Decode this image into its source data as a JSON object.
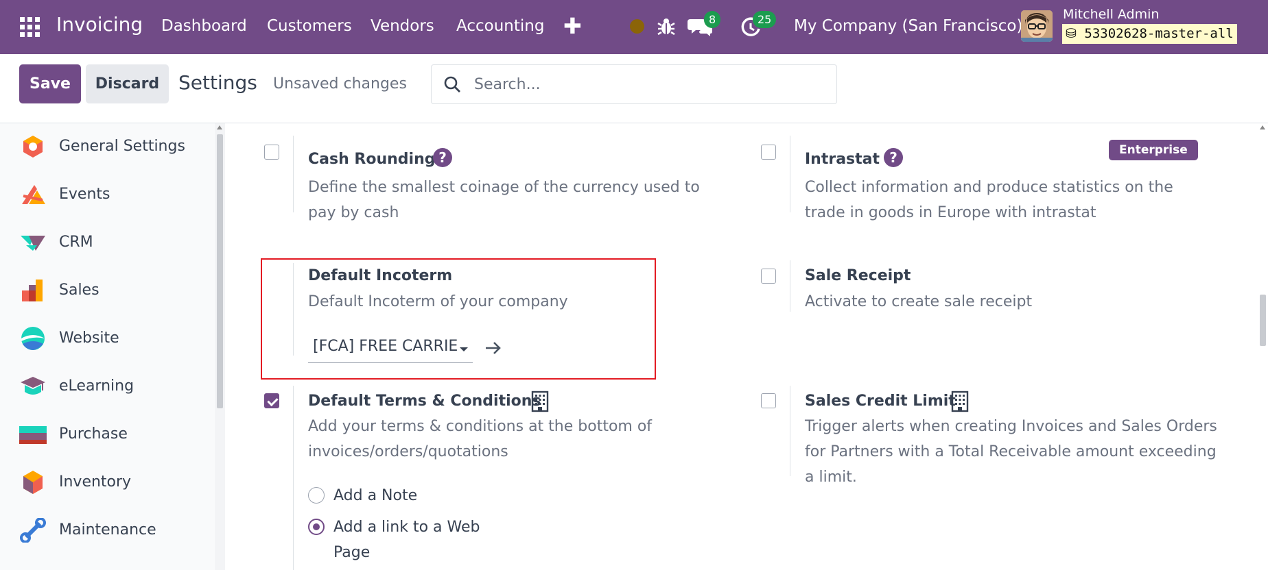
{
  "navbar": {
    "app_name": "Invoicing",
    "menu": [
      "Dashboard",
      "Customers",
      "Vendors",
      "Accounting"
    ],
    "plus_icon": "plus-icon",
    "chat_count": "8",
    "activity_count": "25",
    "company": "My Company (San Francisco)",
    "user_name": "Mitchell Admin",
    "database": "53302628-master-all",
    "colors": {
      "bar": "#714B87",
      "badge": "#1C9C4F",
      "status_dot": "#8B6408"
    }
  },
  "control_panel": {
    "save_label": "Save",
    "discard_label": "Discard",
    "title": "Settings",
    "status": "Unsaved changes",
    "search_placeholder": "Search..."
  },
  "sidebar": {
    "items": [
      {
        "label": "General Settings",
        "icon": "general-settings-icon"
      },
      {
        "label": "Events",
        "icon": "events-icon"
      },
      {
        "label": "CRM",
        "icon": "crm-icon"
      },
      {
        "label": "Sales",
        "icon": "sales-icon"
      },
      {
        "label": "Website",
        "icon": "website-icon"
      },
      {
        "label": "eLearning",
        "icon": "elearning-icon"
      },
      {
        "label": "Purchase",
        "icon": "purchase-icon"
      },
      {
        "label": "Inventory",
        "icon": "inventory-icon"
      },
      {
        "label": "Maintenance",
        "icon": "maintenance-icon"
      }
    ]
  },
  "settings": {
    "cash_rounding": {
      "title": "Cash Rounding",
      "desc": "Define the smallest coinage of the currency used to pay by cash",
      "checked": false
    },
    "intrastat": {
      "title": "Intrastat",
      "desc": "Collect information and produce statistics on the trade in goods in Europe with intrastat",
      "badge": "Enterprise",
      "checked": false
    },
    "default_incoterm": {
      "title": "Default Incoterm",
      "desc": "Default Incoterm of your company",
      "value": "[FCA] FREE CARRIE"
    },
    "sale_receipt": {
      "title": "Sale Receipt",
      "desc": "Activate to create sale receipt",
      "checked": false
    },
    "terms_conditions": {
      "title": "Default Terms & Conditions",
      "desc": "Add your terms & conditions at the bottom of invoices/orders/quotations",
      "checked": true,
      "options": [
        {
          "label": "Add a Note",
          "selected": false
        },
        {
          "label": "Add a link to a Web Page",
          "selected": true
        }
      ]
    },
    "sales_credit_limit": {
      "title": "Sales Credit Limit",
      "desc": "Trigger alerts when creating Invoices and Sales Orders for Partners with a Total Receivable amount exceeding a limit.",
      "checked": false
    }
  },
  "accent_color": "#714B87",
  "highlight_color": "#E31B23"
}
